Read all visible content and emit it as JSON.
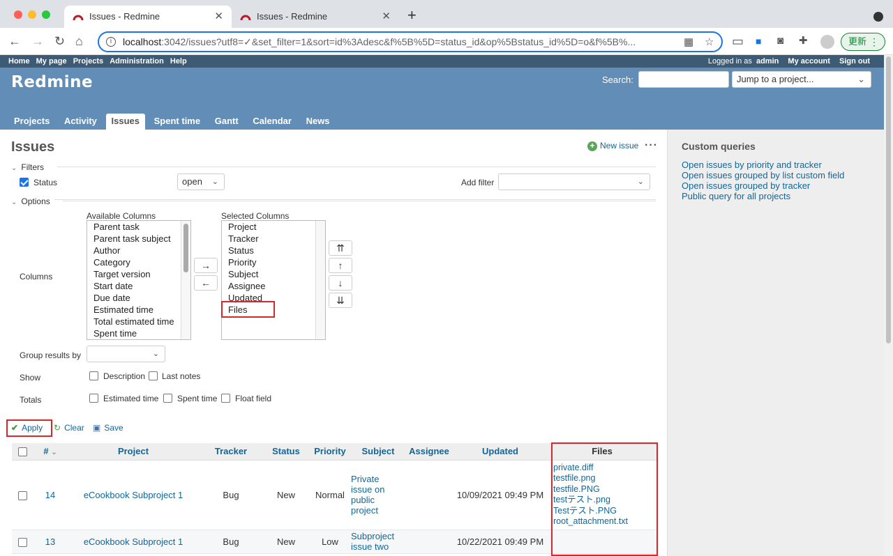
{
  "browser": {
    "tabs": [
      {
        "title": "Issues - Redmine",
        "active": true
      },
      {
        "title": "Issues - Redmine",
        "active": false
      }
    ],
    "url_host": "localhost",
    "url_rest": ":3042/issues?utf8=✓&set_filter=1&sort=id%3Adesc&f%5B%5D=status_id&op%5Bstatus_id%5D=o&f%5B%...",
    "update_label": "更新"
  },
  "top_menu": {
    "left": [
      "Home",
      "My page",
      "Projects",
      "Administration",
      "Help"
    ],
    "logged_prefix": "Logged in as",
    "user": "admin",
    "my_account": "My account",
    "sign_out": "Sign out"
  },
  "header": {
    "app_title": "Redmine",
    "search_label": "Search:",
    "jump_placeholder": "Jump to a project...",
    "tabs": [
      "Projects",
      "Activity",
      "Issues",
      "Spent time",
      "Gantt",
      "Calendar",
      "News"
    ],
    "selected_tab": "Issues"
  },
  "content": {
    "title": "Issues",
    "new_issue": "New issue",
    "filters_legend": "Filters",
    "status_label": "Status",
    "status_value": "open",
    "add_filter_label": "Add filter",
    "options_legend": "Options",
    "columns_label": "Columns",
    "available_title": "Available Columns",
    "available": [
      "Parent task",
      "Parent task subject",
      "Author",
      "Category",
      "Target version",
      "Start date",
      "Due date",
      "Estimated time",
      "Total estimated time",
      "Spent time"
    ],
    "selected_title": "Selected Columns",
    "selected": [
      "Project",
      "Tracker",
      "Status",
      "Priority",
      "Subject",
      "Assignee",
      "Updated",
      "Files"
    ],
    "move_right": "→",
    "move_left": "←",
    "move_top": "⇈",
    "move_up": "↑",
    "move_down": "↓",
    "move_bottom": "⇊",
    "group_label": "Group results by",
    "show_label": "Show",
    "show_options": [
      "Description",
      "Last notes"
    ],
    "totals_label": "Totals",
    "totals_options": [
      "Estimated time",
      "Spent time",
      "Float field"
    ],
    "apply": "Apply",
    "clear": "Clear",
    "save": "Save"
  },
  "table": {
    "headers": {
      "id": "#",
      "project": "Project",
      "tracker": "Tracker",
      "status": "Status",
      "priority": "Priority",
      "subject": "Subject",
      "assignee": "Assignee",
      "updated": "Updated",
      "files": "Files"
    },
    "rows": [
      {
        "id": "14",
        "project": "eCookbook Subproject 1",
        "tracker": "Bug",
        "status": "New",
        "priority": "Normal",
        "subject": "Private issue on public project",
        "assignee": "",
        "updated": "10/09/2021 09:49 PM",
        "files": [
          "private.diff",
          "testfile.png",
          "testfile.PNG",
          "testテスト.png",
          "Testテスト.PNG",
          "root_attachment.txt"
        ]
      },
      {
        "id": "13",
        "project": "eCookbook Subproject 1",
        "tracker": "Bug",
        "status": "New",
        "priority": "Low",
        "subject": "Subproject issue two",
        "assignee": "",
        "updated": "10/22/2021 09:49 PM",
        "files": []
      }
    ]
  },
  "sidebar": {
    "title": "Custom queries",
    "queries": [
      "Open issues by priority and tracker",
      "Open issues grouped by list custom field",
      "Open issues grouped by tracker",
      "Public query for all projects"
    ]
  },
  "colors": {
    "header": "#628db6",
    "top_menu": "#3e5b76",
    "link": "#169",
    "highlight": "#d9262c"
  }
}
